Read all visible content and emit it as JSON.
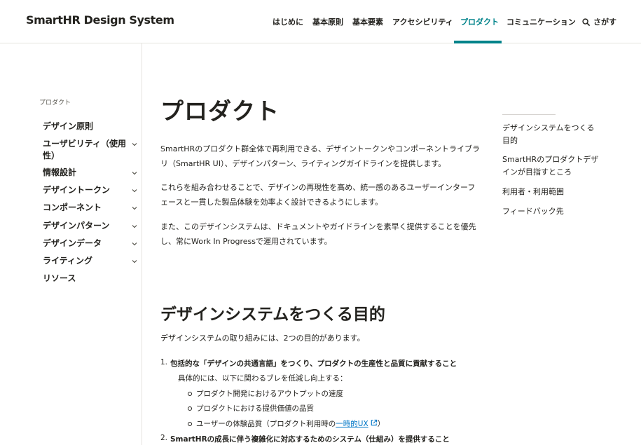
{
  "header": {
    "logo": "SmartHR Design System",
    "nav": [
      {
        "label": "はじめに"
      },
      {
        "label": "基本原則"
      },
      {
        "label": "基本要素"
      },
      {
        "label": "アクセシビリティ"
      },
      {
        "label": "プロダクト",
        "active": true
      },
      {
        "label": "コミュニケーション"
      }
    ],
    "search_label": "さがす",
    "accent_color": "#00838a"
  },
  "sidebar": {
    "section_label": "プロダクト",
    "items": [
      {
        "label": "デザイン原則",
        "expandable": false
      },
      {
        "label": "ユーザビリティ（使用性）",
        "expandable": true
      },
      {
        "label": "情報設計",
        "expandable": true
      },
      {
        "label": "デザイントークン",
        "expandable": true
      },
      {
        "label": "コンポーネント",
        "expandable": true
      },
      {
        "label": "デザインパターン",
        "expandable": true
      },
      {
        "label": "デザインデータ",
        "expandable": true
      },
      {
        "label": "ライティング",
        "expandable": true
      },
      {
        "label": "リソース",
        "expandable": false
      }
    ]
  },
  "main": {
    "title": "プロダクト",
    "intro": [
      "SmartHRのプロダクト群全体で再利用できる、デザイントークンやコンポーネントライブラリ（SmartHR UI）、デザインパターン、ライティングガイドラインを提供します。",
      "これらを組み合わせることで、デザインの再現性を高め、統一感のあるユーザーインターフェースと一貫した製品体験を効率よく設計できるようにします。",
      "また、このデザインシステムは、ドキュメントやガイドラインを素早く提供することを優先し、常にWork In Progressで運用されています。"
    ],
    "section_title": "デザインシステムをつくる目的",
    "section_lead": "デザインシステムの取り組みには、2つの目的があります。",
    "goals": [
      {
        "number": "1.",
        "title": "包括的な「デザインの共通言語」をつくり、プロダクトの生産性と品質に貢献すること",
        "detail": "具体的には、以下に関わるブレを低減し向上する：",
        "bullets": [
          "プロダクト開発におけるアウトプットの速度",
          "プロダクトにおける提供価値の品質"
        ],
        "bullet_link_prefix": "ユーザーの体験品質（プロダクト利用時の",
        "bullet_link_text": "一時的UX",
        "bullet_link_suffix": "）"
      },
      {
        "number": "2.",
        "title": "SmartHRの成長に伴う複雑化に対応するためのシステム（仕組み）を提供すること"
      }
    ]
  },
  "toc": {
    "items": [
      {
        "label": "デザインシステムをつくる目的"
      },
      {
        "label": "SmartHRのプロダクトデザインが目指すところ"
      },
      {
        "label": "利用者・利用範囲"
      },
      {
        "label": "フィードバック先"
      }
    ]
  }
}
